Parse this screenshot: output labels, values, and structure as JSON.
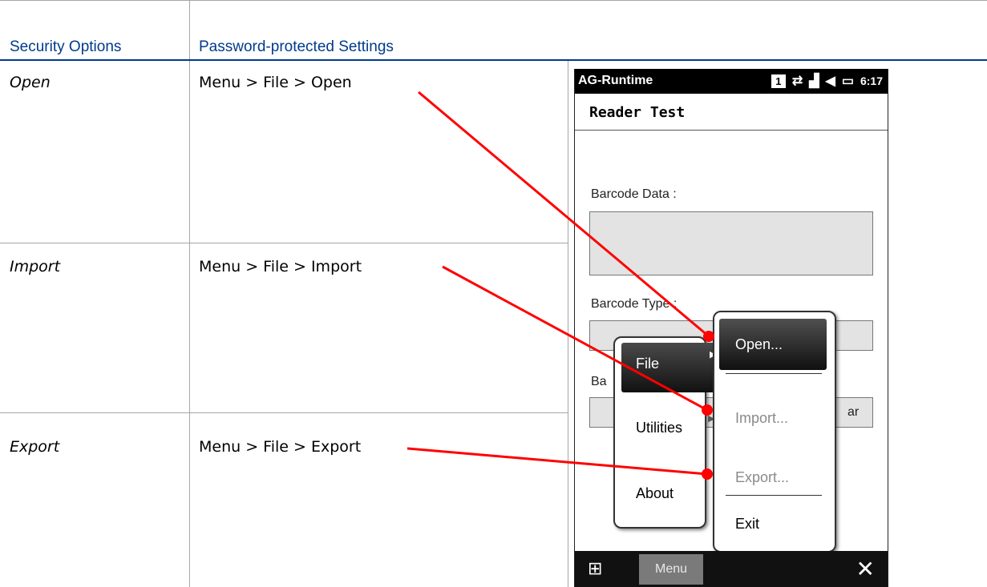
{
  "table": {
    "header_col1": "Security Options",
    "header_col2": "Password-protected Settings",
    "rows": [
      {
        "option": "Open",
        "path": "Menu > File > Open"
      },
      {
        "option": "Import",
        "path": "Menu > File > Import"
      },
      {
        "option": "Export",
        "path": "Menu > File > Export"
      }
    ]
  },
  "phone": {
    "app_name": "AG-Runtime",
    "status_sim": "1",
    "status_time": "6:17",
    "form_title": "Reader Test",
    "barcode_data_label": "Barcode Data :",
    "barcode_type_label": "Barcode Type :",
    "partial_label": "Ba",
    "partial_button": "ar",
    "menu_button": "Menu",
    "context_menu": {
      "file": "File",
      "utilities": "Utilities",
      "about": "About"
    },
    "file_submenu": {
      "open": "Open...",
      "import": "Import...",
      "export": "Export...",
      "exit": "Exit"
    }
  },
  "colors": {
    "header_text": "#003a8c",
    "callout": "#ff0000",
    "table_border": "#a6a6a6"
  }
}
